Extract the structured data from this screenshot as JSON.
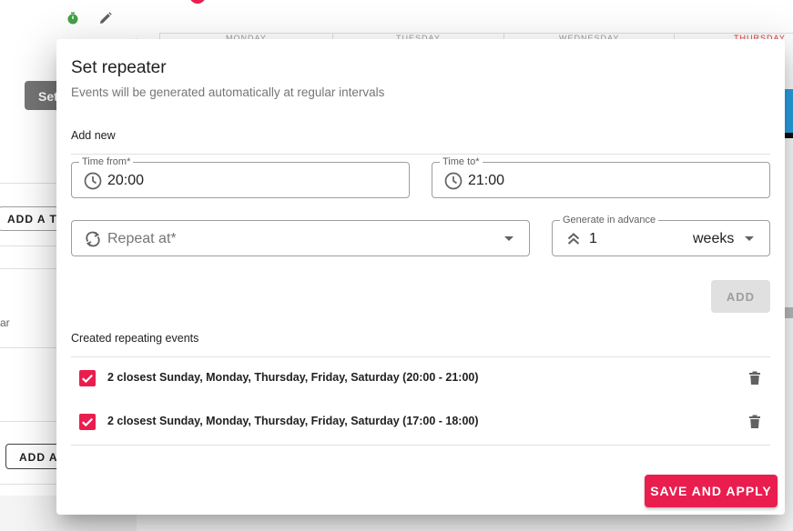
{
  "background": {
    "set_button_label": "Set",
    "add_button_1_label": "ADD A TI",
    "add_button_2_label": "ADD A",
    "partial_text": "ar",
    "days": [
      "MONDAY",
      "TUESDAY",
      "WEDNESDAY",
      "THURSDAY"
    ],
    "highlight_day_color": "#e53935"
  },
  "dialog": {
    "title": "Set repeater",
    "subtitle": "Events will be generated automatically at regular intervals",
    "add_new_label": "Add new",
    "time_from": {
      "label": "Time from*",
      "value": "20:00",
      "icon": "clock-icon"
    },
    "time_to": {
      "label": "Time to*",
      "value": "21:00",
      "icon": "clock-icon"
    },
    "repeat_at": {
      "placeholder": "Repeat at*",
      "icon": "repeat-icon"
    },
    "generate_in_advance": {
      "label": "Generate in advance",
      "value": "1",
      "unit": "weeks",
      "icon": "double-chevron-up-icon"
    },
    "add_button_label": "ADD",
    "created_label": "Created repeating events",
    "events": [
      {
        "text": "2 closest Sunday, Monday, Thursday, Friday, Saturday (20:00 - 21:00)",
        "checked": true
      },
      {
        "text": "2 closest Sunday, Monday, Thursday, Friday, Saturday (17:00 - 18:00)",
        "checked": true
      }
    ],
    "save_button_label": "SAVE AND APPLY"
  },
  "colors": {
    "accent": "#e91e4f",
    "disabled_button": "#e0e0e0",
    "border": "#9e9e9e"
  }
}
